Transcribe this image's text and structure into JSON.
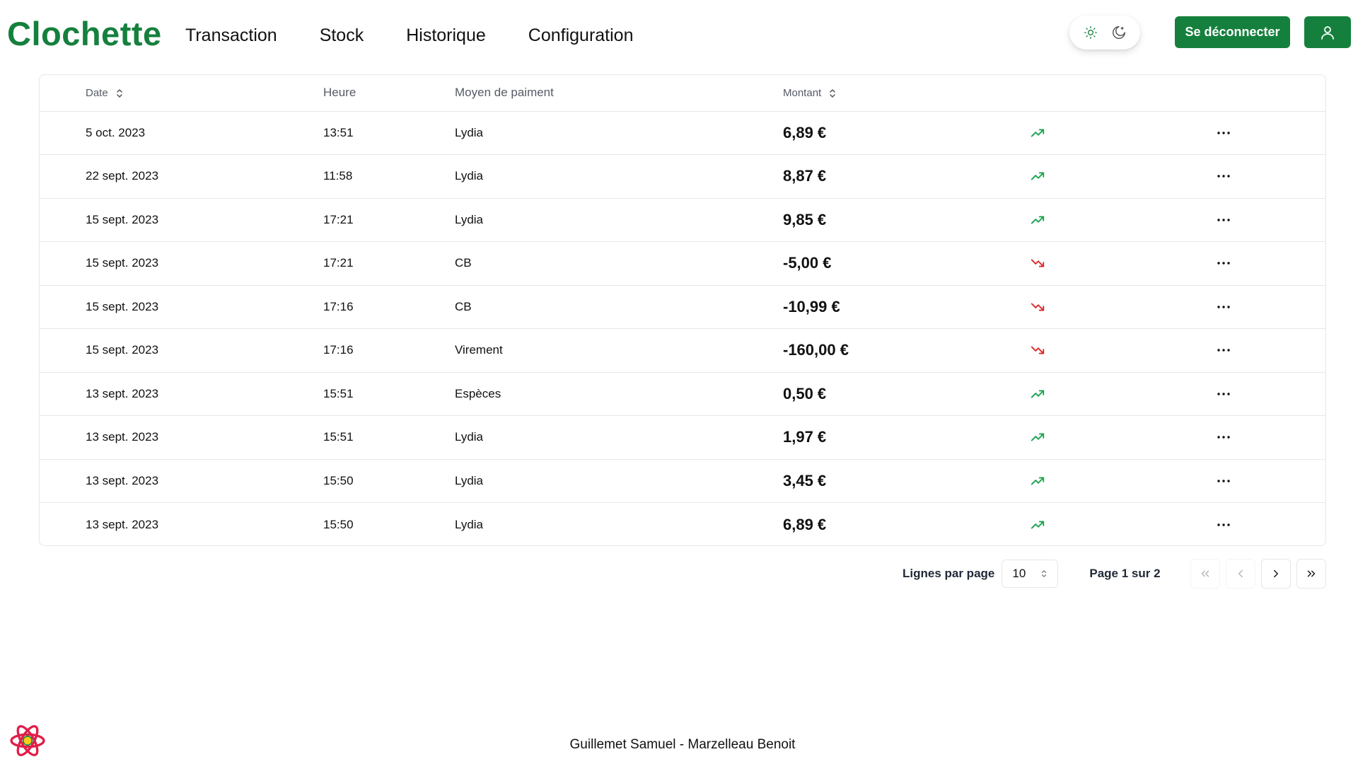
{
  "header": {
    "brand": "Clochette",
    "nav": [
      "Transaction",
      "Stock",
      "Historique",
      "Configuration"
    ],
    "logout_label": "Se déconnecter"
  },
  "table": {
    "columns": {
      "date": "Date",
      "heure": "Heure",
      "moyen": "Moyen de paiment",
      "montant": "Montant"
    },
    "rows": [
      {
        "date": "5 oct. 2023",
        "heure": "13:51",
        "moyen": "Lydia",
        "montant": "6,89 €",
        "trend": "up"
      },
      {
        "date": "22 sept. 2023",
        "heure": "11:58",
        "moyen": "Lydia",
        "montant": "8,87 €",
        "trend": "up"
      },
      {
        "date": "15 sept. 2023",
        "heure": "17:21",
        "moyen": "Lydia",
        "montant": "9,85 €",
        "trend": "up"
      },
      {
        "date": "15 sept. 2023",
        "heure": "17:21",
        "moyen": "CB",
        "montant": "-5,00 €",
        "trend": "down"
      },
      {
        "date": "15 sept. 2023",
        "heure": "17:16",
        "moyen": "CB",
        "montant": "-10,99 €",
        "trend": "down"
      },
      {
        "date": "15 sept. 2023",
        "heure": "17:16",
        "moyen": "Virement",
        "montant": "-160,00 €",
        "trend": "down"
      },
      {
        "date": "13 sept. 2023",
        "heure": "15:51",
        "moyen": "Espèces",
        "montant": "0,50 €",
        "trend": "up"
      },
      {
        "date": "13 sept. 2023",
        "heure": "15:51",
        "moyen": "Lydia",
        "montant": "1,97 €",
        "trend": "up"
      },
      {
        "date": "13 sept. 2023",
        "heure": "15:50",
        "moyen": "Lydia",
        "montant": "3,45 €",
        "trend": "up"
      },
      {
        "date": "13 sept. 2023",
        "heure": "15:50",
        "moyen": "Lydia",
        "montant": "6,89 €",
        "trend": "up"
      }
    ]
  },
  "pagination": {
    "rows_label": "Lignes par page",
    "rows_value": "10",
    "page_info": "Page 1 sur 2"
  },
  "footer": {
    "credits": "Guillemet Samuel - Marzelleau Benoit"
  },
  "colors": {
    "brand": "#15803d",
    "trend_up": "#16a34a",
    "trend_down": "#dc2626",
    "border": "#e5e7eb"
  },
  "icons": {
    "theme_light": "sun-icon",
    "theme_dark": "moon-icon",
    "profile": "user-icon",
    "sort": "chevrons-up-down-icon",
    "trend_up": "trending-up-icon",
    "trend_down": "trending-down-icon",
    "row_menu": "ellipsis-icon",
    "first_page": "chevrons-left-icon",
    "prev_page": "chevron-left-icon",
    "next_page": "chevron-right-icon",
    "last_page": "chevrons-right-icon",
    "footer_logo": "react-logo-icon"
  }
}
